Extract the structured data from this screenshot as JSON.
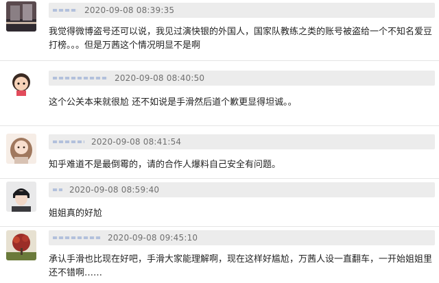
{
  "comments": [
    {
      "time": "2020-09-08 08:39:35",
      "text": "我觉得微博盗号还可以说，我见过演快银的外国人，国家队教练之类的账号被盗给一个不知名爱豆打榜。。。但是万茜这个情况明显不是啊"
    },
    {
      "time": "2020-09-08 08:40:50",
      "text": "这个公关本来就很尬 还不如说是手滑然后道个歉更显得坦诚。。"
    },
    {
      "time": "2020-09-08 08:41:54",
      "text": "知乎难道不是最倒霉的，请的合作人爆料自己安全有问题。"
    },
    {
      "time": "2020-09-08 08:59:40",
      "text": "姐姐真的好尬"
    },
    {
      "time": "2020-09-08 09:45:10",
      "text": "承认手滑也比现在好吧，手滑大家能理解啊，现在这样好尴尬，万茜人设一直翻车，一开始姐姐里还不错啊……"
    }
  ]
}
